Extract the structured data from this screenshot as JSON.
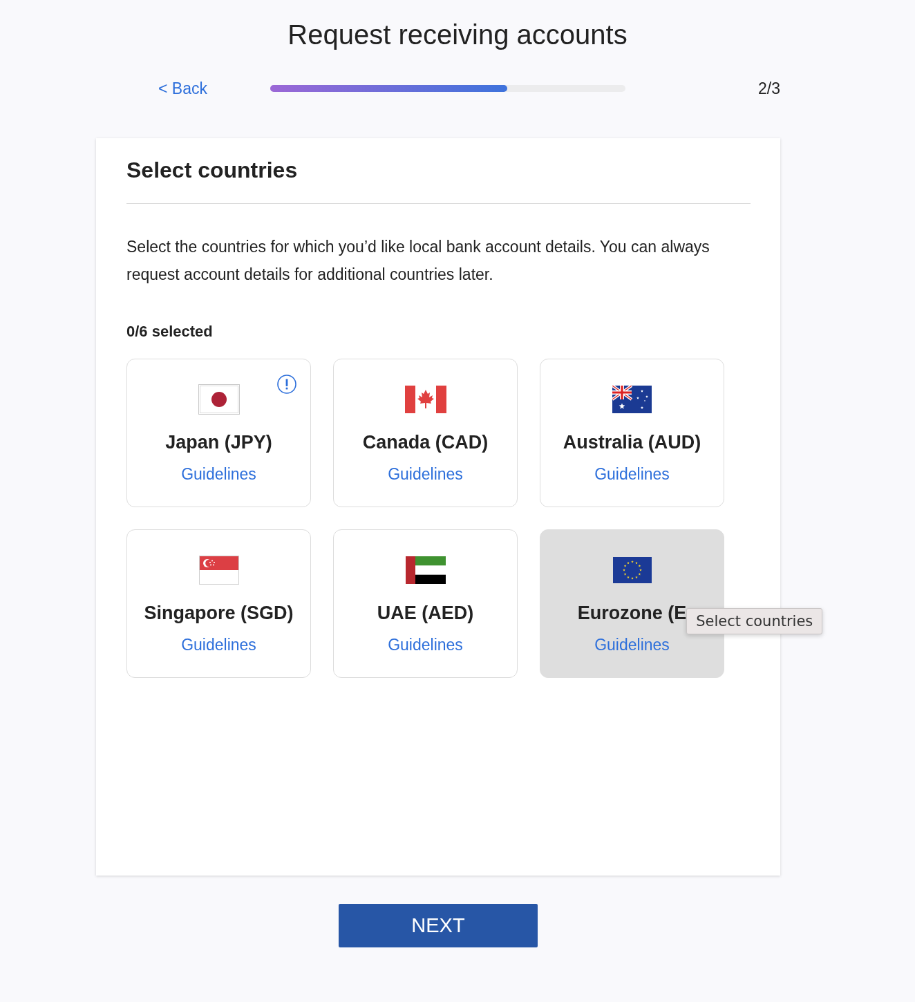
{
  "page": {
    "title": "Request receiving accounts"
  },
  "nav": {
    "back": "< Back",
    "progress": {
      "level": 0.667
    },
    "step": "2/3"
  },
  "card": {
    "title": "Select countries",
    "description": "Select the countries for which you’d like local bank account details. You can always request account details for additional countries later.",
    "selection_count": "0/6 selected",
    "countries": [
      {
        "kind": "japan",
        "name": "Japan (JPY)",
        "link": "Guidelines",
        "alert": true,
        "selected": false,
        "hovered": false
      },
      {
        "kind": "canada",
        "name": "Canada (CAD)",
        "link": "Guidelines",
        "alert": false,
        "selected": false,
        "hovered": false
      },
      {
        "kind": "australia",
        "name": "Australia (AUD)",
        "link": "Guidelines",
        "alert": false,
        "selected": false,
        "hovered": false
      },
      {
        "kind": "singapore",
        "name": "Singapore (SGD)",
        "link": "Guidelines",
        "alert": false,
        "selected": false,
        "hovered": false
      },
      {
        "kind": "uae",
        "name": "UAE (AED)",
        "link": "Guidelines",
        "alert": false,
        "selected": false,
        "hovered": false
      },
      {
        "kind": "eu",
        "name": "Eurozone (E",
        "link": "Guidelines",
        "alert": false,
        "selected": false,
        "hovered": true,
        "tooltip": "Select countries"
      }
    ]
  },
  "next_button": {
    "label": "NEXT"
  }
}
